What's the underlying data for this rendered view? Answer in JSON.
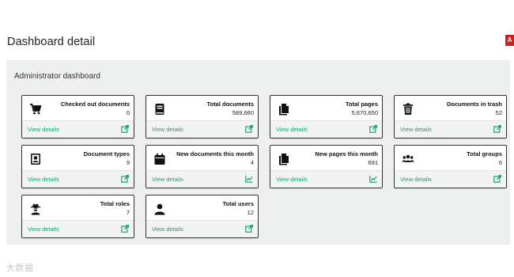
{
  "page": {
    "title": "Dashboard detail"
  },
  "corner_badge": "A",
  "panel": {
    "title": "Administrator dashboard"
  },
  "colors": {
    "accent": "#1aa179",
    "panel_bg": "#eef0f0",
    "badge": "#cc1f1f"
  },
  "cards": [
    {
      "label": "Checked out documents",
      "value": "0",
      "icon": "cart-icon",
      "link": "View details",
      "footer_icon": "external-link-icon"
    },
    {
      "label": "Total documents",
      "value": "589,660",
      "icon": "book-icon",
      "link": "View details",
      "footer_icon": "external-link-icon"
    },
    {
      "label": "Total pages",
      "value": "5,670,650",
      "icon": "files-icon",
      "link": "View details",
      "footer_icon": "external-link-icon"
    },
    {
      "label": "Documents in trash",
      "value": "52",
      "icon": "trash-icon",
      "link": "View details",
      "footer_icon": "external-link-icon"
    },
    {
      "label": "Document types",
      "value": "9",
      "icon": "document-type-icon",
      "link": "View details",
      "footer_icon": "external-link-icon"
    },
    {
      "label": "New documents this month",
      "value": "4",
      "icon": "calendar-icon",
      "link": "View details",
      "footer_icon": "line-chart-icon"
    },
    {
      "label": "New pages this month",
      "value": "691",
      "icon": "files-icon",
      "link": "View details",
      "footer_icon": "line-chart-icon"
    },
    {
      "label": "Total groups",
      "value": "6",
      "icon": "users-icon",
      "link": "View details",
      "footer_icon": "external-link-icon"
    },
    {
      "label": "Total roles",
      "value": "7",
      "icon": "user-secret-icon",
      "link": "View details",
      "footer_icon": "external-link-icon"
    },
    {
      "label": "Total users",
      "value": "12",
      "icon": "user-icon",
      "link": "View details",
      "footer_icon": "external-link-icon"
    }
  ],
  "watermark": "大数据"
}
